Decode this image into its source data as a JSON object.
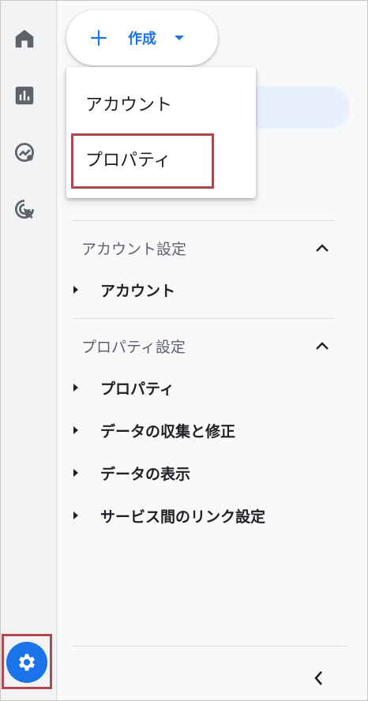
{
  "create": {
    "label": "作成",
    "menu": [
      {
        "label": "アカウント"
      },
      {
        "label": "プロパティ"
      }
    ]
  },
  "sections": {
    "account": {
      "title": "アカウント設定",
      "items": [
        "アカウント"
      ]
    },
    "property": {
      "title": "プロパティ設定",
      "items": [
        "プロパティ",
        "データの収集と修正",
        "データの表示",
        "サービス間のリンク設定"
      ]
    }
  },
  "rail": {
    "icons": [
      "home-icon",
      "reports-icon",
      "explore-icon",
      "advertising-icon",
      "settings-icon"
    ]
  },
  "colors": {
    "accent": "#1a73e8",
    "highlight_border": "#b3474f",
    "selected_bg": "#e8f0fe"
  }
}
